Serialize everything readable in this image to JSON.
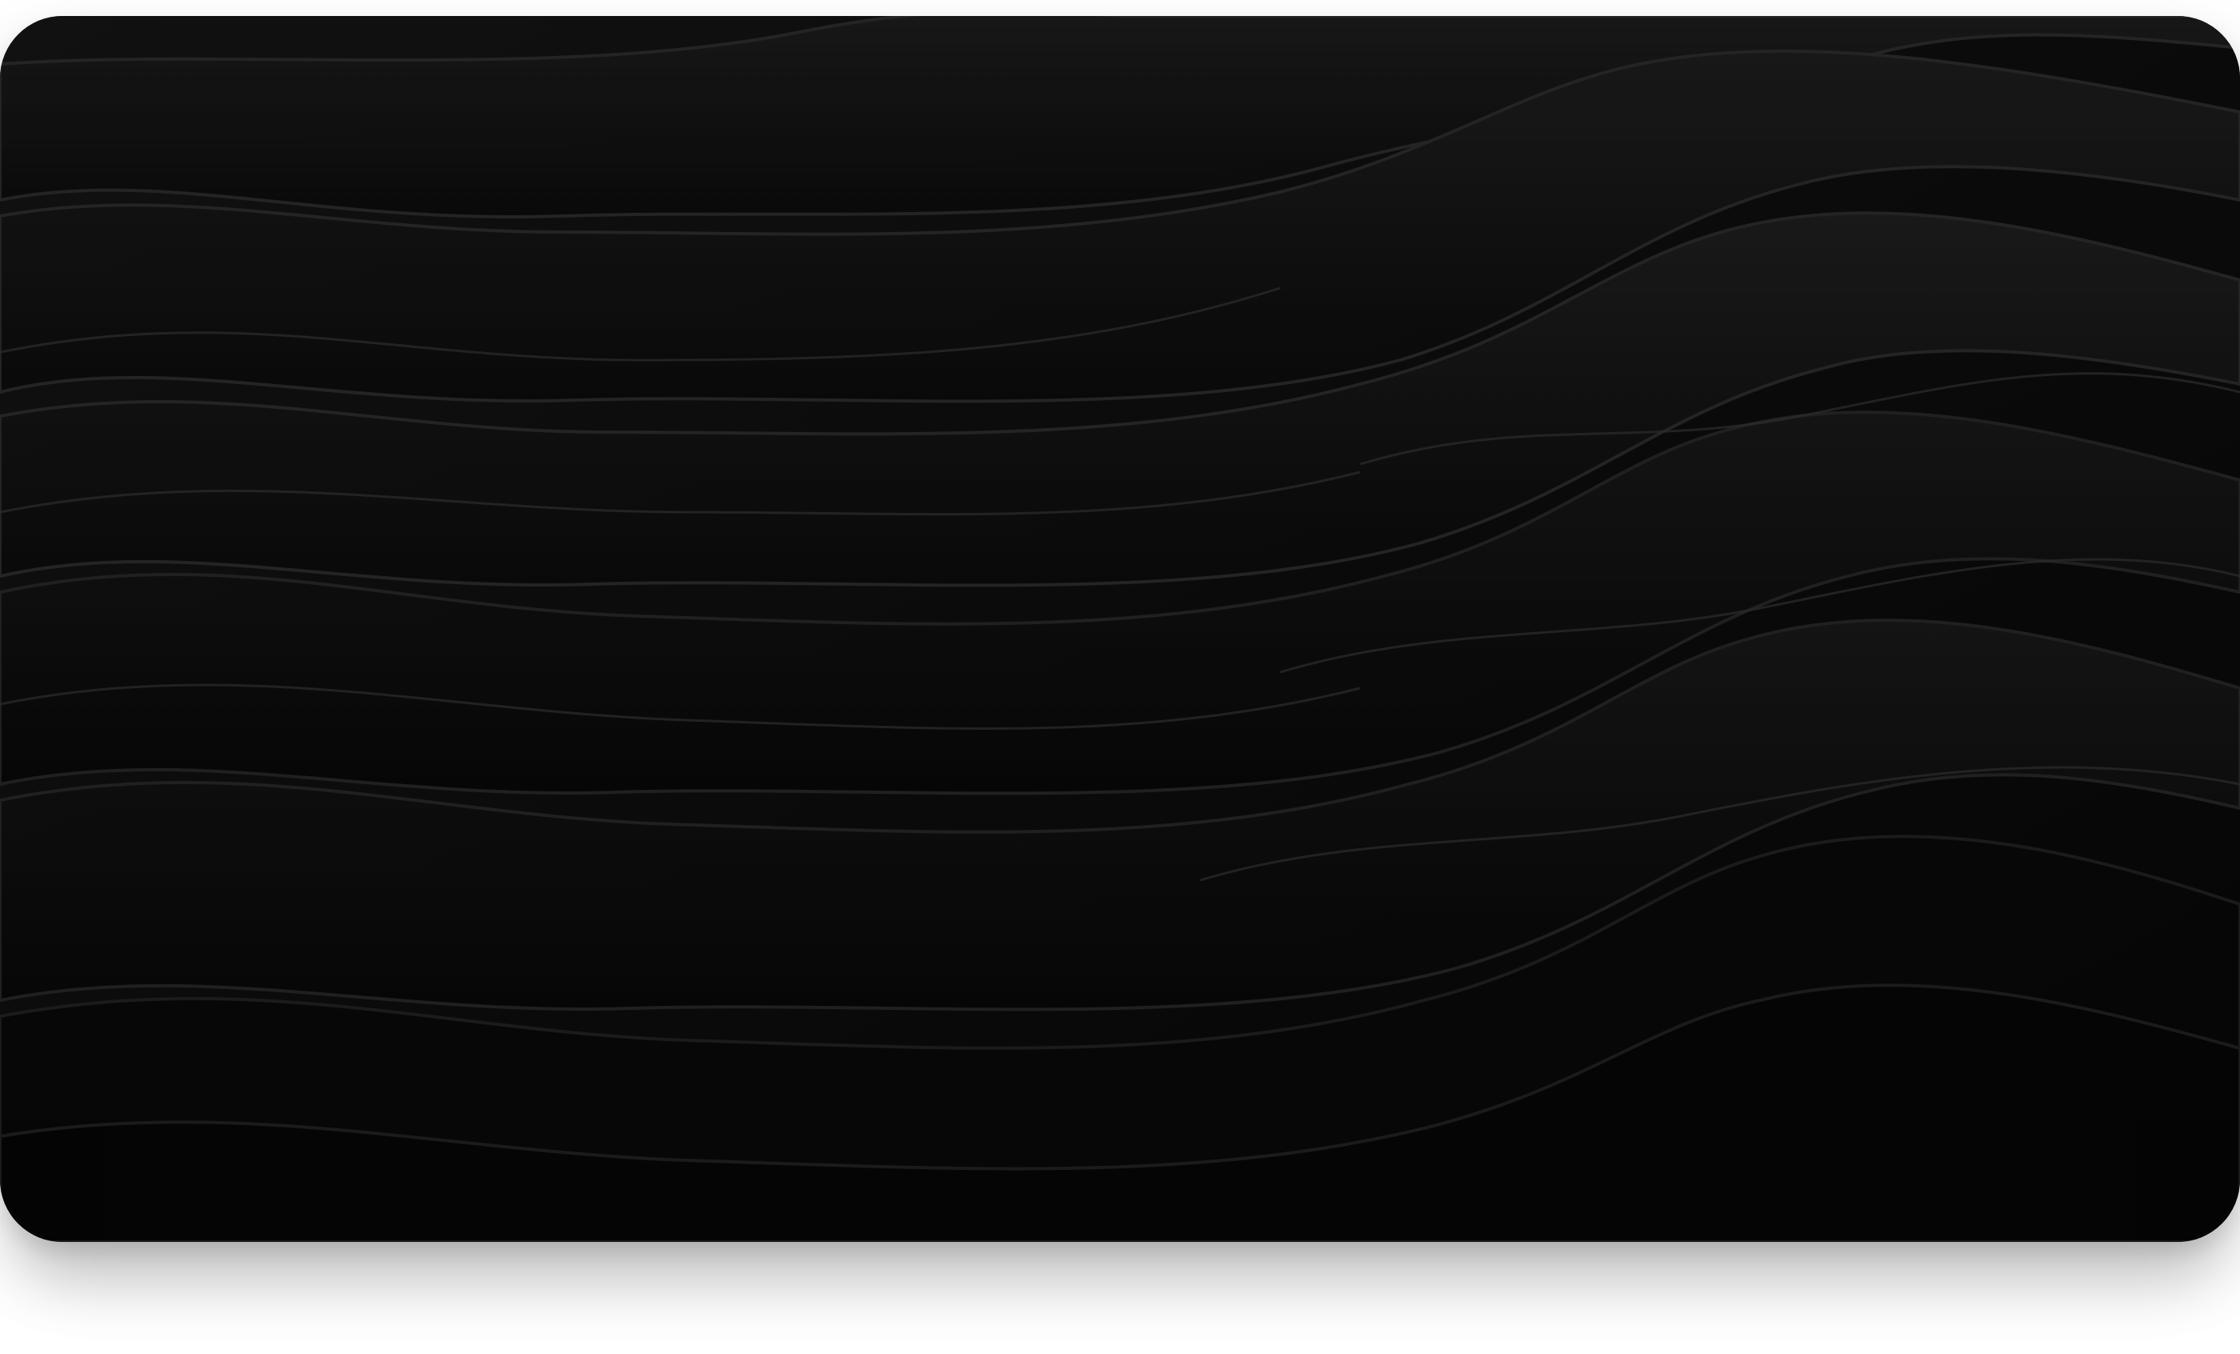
{
  "wallpaper": {
    "icon": "wave-wallpaper-icon",
    "colors": {
      "base": "#0b0b0b",
      "band_dark": "#070707",
      "band_mid": "#121212",
      "band_light": "#1a1a1a",
      "highlight": "#2a2a2a",
      "page_background": "#ffffff"
    }
  }
}
